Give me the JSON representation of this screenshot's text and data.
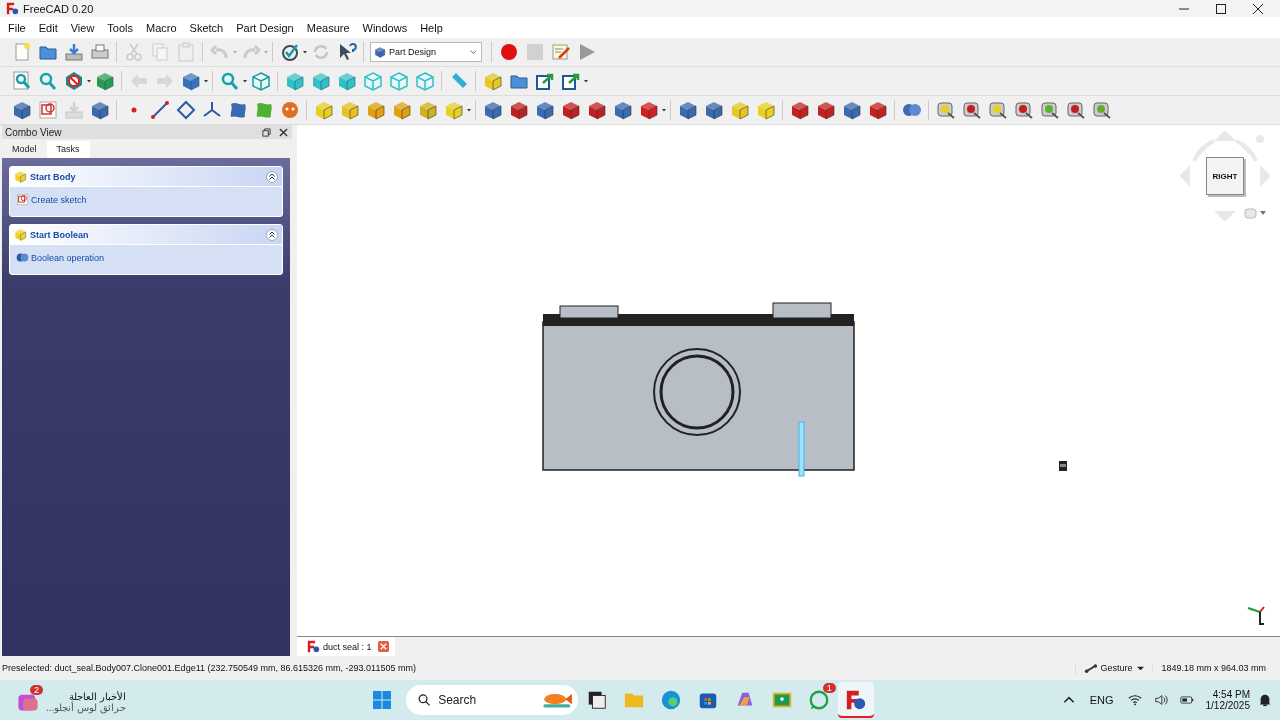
{
  "window": {
    "title": "FreeCAD 0.20"
  },
  "menu": [
    "File",
    "Edit",
    "View",
    "Tools",
    "Macro",
    "Sketch",
    "Part Design",
    "Measure",
    "Windows",
    "Help"
  ],
  "toolbars": [
    [
      [
        {
          "kind": "new",
          "disabled": false
        },
        {
          "kind": "open",
          "disabled": false
        },
        {
          "kind": "save",
          "disabled": false
        },
        {
          "kind": "print",
          "disabled": false
        }
      ],
      [
        {
          "kind": "cut",
          "disabled": true
        },
        {
          "kind": "copy",
          "disabled": true
        },
        {
          "kind": "paste",
          "disabled": true
        }
      ],
      [
        {
          "kind": "undo",
          "disabled": true
        },
        {
          "kind": "caret",
          "disabled": true
        },
        {
          "kind": "redo",
          "disabled": true
        },
        {
          "kind": "caret",
          "disabled": true
        }
      ],
      [
        {
          "kind": "check",
          "disabled": false
        },
        {
          "kind": "caret",
          "disabled": false
        },
        {
          "kind": "refresh",
          "disabled": true
        },
        {
          "kind": "help",
          "disabled": false
        }
      ],
      [
        {
          "kind": "workbench",
          "label": "Part Design",
          "disabled": false
        }
      ],
      [
        {
          "kind": "record",
          "disabled": false
        },
        {
          "kind": "stop",
          "disabled": true
        },
        {
          "kind": "macro",
          "disabled": false
        },
        {
          "kind": "play",
          "disabled": false
        }
      ]
    ],
    [
      [
        {
          "kind": "fit-all",
          "disabled": false
        },
        {
          "kind": "fit-selection",
          "disabled": false
        },
        {
          "kind": "draw-style",
          "disabled": false
        },
        {
          "kind": "caret",
          "disabled": false
        },
        {
          "kind": "box-select",
          "disabled": false
        }
      ],
      [
        {
          "kind": "back",
          "disabled": true
        },
        {
          "kind": "forward",
          "disabled": true
        },
        {
          "kind": "sync",
          "disabled": false
        },
        {
          "kind": "caret",
          "disabled": false
        }
      ],
      [
        {
          "kind": "zoom",
          "disabled": false
        },
        {
          "kind": "caret",
          "disabled": false
        },
        {
          "kind": "iso",
          "disabled": false
        }
      ],
      [
        {
          "kind": "front",
          "disabled": false
        },
        {
          "kind": "top",
          "disabled": false
        },
        {
          "kind": "right",
          "disabled": false
        },
        {
          "kind": "rear",
          "disabled": false
        },
        {
          "kind": "bottom",
          "disabled": false
        },
        {
          "kind": "left",
          "disabled": false
        }
      ],
      [
        {
          "kind": "ruler",
          "disabled": false
        }
      ],
      [
        {
          "kind": "part",
          "disabled": false
        },
        {
          "kind": "group",
          "disabled": false
        },
        {
          "kind": "link",
          "disabled": false
        },
        {
          "kind": "link-sub",
          "disabled": false
        },
        {
          "kind": "caret",
          "disabled": false
        }
      ]
    ],
    [
      [
        {
          "kind": "body",
          "disabled": false
        },
        {
          "kind": "sketch",
          "disabled": false
        },
        {
          "kind": "import",
          "disabled": true
        },
        {
          "kind": "binder",
          "disabled": false
        }
      ],
      [
        {
          "kind": "point",
          "disabled": false
        },
        {
          "kind": "line",
          "disabled": false
        },
        {
          "kind": "plane",
          "disabled": false
        },
        {
          "kind": "lcs",
          "disabled": false
        },
        {
          "kind": "subbinder",
          "disabled": false
        },
        {
          "kind": "clone",
          "disabled": false
        },
        {
          "kind": "sprite",
          "disabled": false
        }
      ],
      [
        {
          "kind": "pad",
          "disabled": false
        },
        {
          "kind": "revolution",
          "disabled": false
        },
        {
          "kind": "loft",
          "disabled": false
        },
        {
          "kind": "pipe",
          "disabled": false
        },
        {
          "kind": "helix",
          "disabled": false
        },
        {
          "kind": "add-primitive",
          "disabled": false
        },
        {
          "kind": "caret",
          "disabled": false
        }
      ],
      [
        {
          "kind": "pocket",
          "disabled": false
        },
        {
          "kind": "hole",
          "disabled": false
        },
        {
          "kind": "groove",
          "disabled": false
        },
        {
          "kind": "sub-loft",
          "disabled": false
        },
        {
          "kind": "sub-pipe",
          "disabled": false
        },
        {
          "kind": "sub-helix",
          "disabled": false
        },
        {
          "kind": "sub-primitive",
          "disabled": false
        },
        {
          "kind": "caret",
          "disabled": false
        }
      ],
      [
        {
          "kind": "mirrored",
          "disabled": false
        },
        {
          "kind": "linear",
          "disabled": false
        },
        {
          "kind": "polar",
          "disabled": false
        },
        {
          "kind": "multi",
          "disabled": false
        }
      ],
      [
        {
          "kind": "fillet",
          "disabled": false
        },
        {
          "kind": "chamfer",
          "disabled": false
        },
        {
          "kind": "draft",
          "disabled": false
        },
        {
          "kind": "thickness",
          "disabled": false
        }
      ],
      [
        {
          "kind": "boolean",
          "disabled": false
        }
      ],
      [
        {
          "kind": "measure",
          "disabled": false
        },
        {
          "kind": "measure-x",
          "disabled": false
        },
        {
          "kind": "measure",
          "disabled": false
        },
        {
          "kind": "measure-x",
          "disabled": false
        },
        {
          "kind": "measure-g",
          "disabled": false
        },
        {
          "kind": "measure-x",
          "disabled": false
        },
        {
          "kind": "measure-g",
          "disabled": false
        }
      ]
    ]
  ],
  "combo_view": {
    "title": "Combo View",
    "tabs": [
      {
        "label": "Model",
        "selected": false
      },
      {
        "label": "Tasks",
        "selected": true
      }
    ],
    "task_panels": [
      {
        "title": "Start Body",
        "expanded": true,
        "actions": [
          {
            "kind": "sketch",
            "label": "Create sketch"
          }
        ]
      },
      {
        "title": "Start Boolean",
        "expanded": true,
        "actions": [
          {
            "kind": "boolean",
            "label": "Boolean operation"
          }
        ]
      }
    ]
  },
  "view3d": {
    "nav_cube": {
      "face": "RIGHT"
    }
  },
  "document_tabs": [
    {
      "label": "duct seal : 1",
      "selected": true
    }
  ],
  "status_bar": {
    "message": "Preselected: duct_seal.Body007.Clone001.Edge11 (232.750549 mm, 86.615326 mm, -293.011505 mm)",
    "navigation": "Gesture",
    "dimensions": "1849.18 mm x 964.03 mm"
  },
  "taskbar": {
    "news": {
      "badge": "2",
      "title": "الأخبار العاجلة",
      "subtitle": "حرائق لوس أنجلو..."
    },
    "search": {
      "placeholder": "Search"
    },
    "apps": [
      {
        "kind": "task-view",
        "selected": false
      },
      {
        "kind": "explorer",
        "selected": false
      },
      {
        "kind": "edge",
        "selected": false
      },
      {
        "kind": "store",
        "selected": false
      },
      {
        "kind": "copilot",
        "selected": false
      },
      {
        "kind": "classroom",
        "selected": false
      },
      {
        "kind": "whatsapp",
        "selected": false,
        "badge": "1"
      },
      {
        "kind": "freecad",
        "selected": true
      }
    ],
    "language": "ENG",
    "time": "4:54 PM",
    "date": "1/12/2025"
  }
}
